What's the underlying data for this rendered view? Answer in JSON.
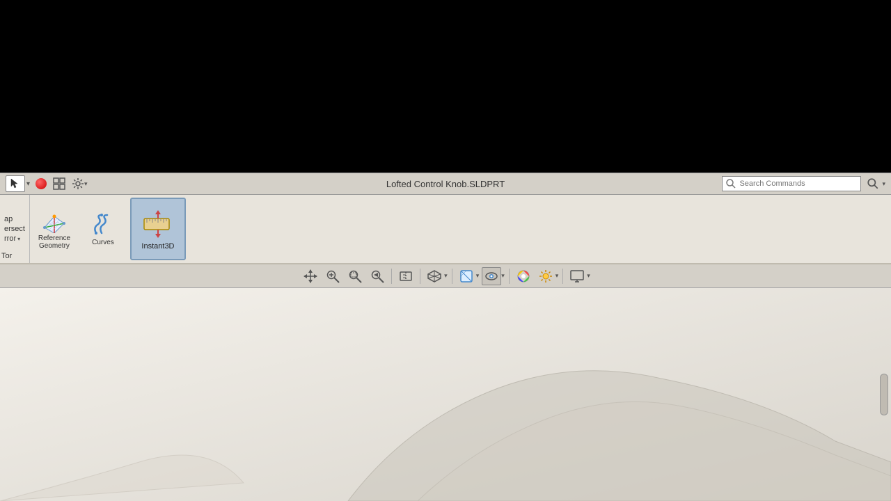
{
  "app": {
    "title": "Lofted Control Knob.SLDPRT"
  },
  "toolbar": {
    "search_placeholder": "Search Commands",
    "arrow_label": "Select",
    "red_dot_label": "Stop Recording",
    "settings_label": "Settings"
  },
  "ribbon": {
    "partial_labels": {
      "ap_label": "ap",
      "ersect_label": "ersect",
      "rror_label": "rror",
      "tor_label": "Tor"
    },
    "buttons": [
      {
        "id": "reference-geometry",
        "label": "Reference\nGeometry",
        "icon": "ref-geo"
      },
      {
        "id": "curves",
        "label": "Curves",
        "icon": "curves"
      },
      {
        "id": "instant3d",
        "label": "Instant3D",
        "icon": "instant3d",
        "active": true
      }
    ]
  },
  "toolbar2": {
    "buttons": [
      {
        "id": "move-view",
        "icon": "move-icon",
        "active": false
      },
      {
        "id": "zoom-fit",
        "icon": "zoom-fit-icon",
        "active": false
      },
      {
        "id": "zoom-box",
        "icon": "zoom-box-icon",
        "active": false
      },
      {
        "id": "zoom-prev",
        "icon": "zoom-prev-icon",
        "active": false
      },
      {
        "id": "section-view",
        "icon": "section-view-icon",
        "active": false
      },
      {
        "id": "3d-view",
        "icon": "3d-view-icon",
        "active": false
      },
      {
        "id": "display-style",
        "icon": "display-style-icon",
        "active": false
      },
      {
        "id": "display-mode",
        "icon": "display-mode-icon",
        "active": true
      },
      {
        "id": "appearances",
        "icon": "appearances-icon",
        "active": false
      },
      {
        "id": "scene",
        "icon": "scene-icon",
        "active": false
      },
      {
        "id": "monitor",
        "icon": "monitor-icon",
        "active": false
      }
    ]
  }
}
